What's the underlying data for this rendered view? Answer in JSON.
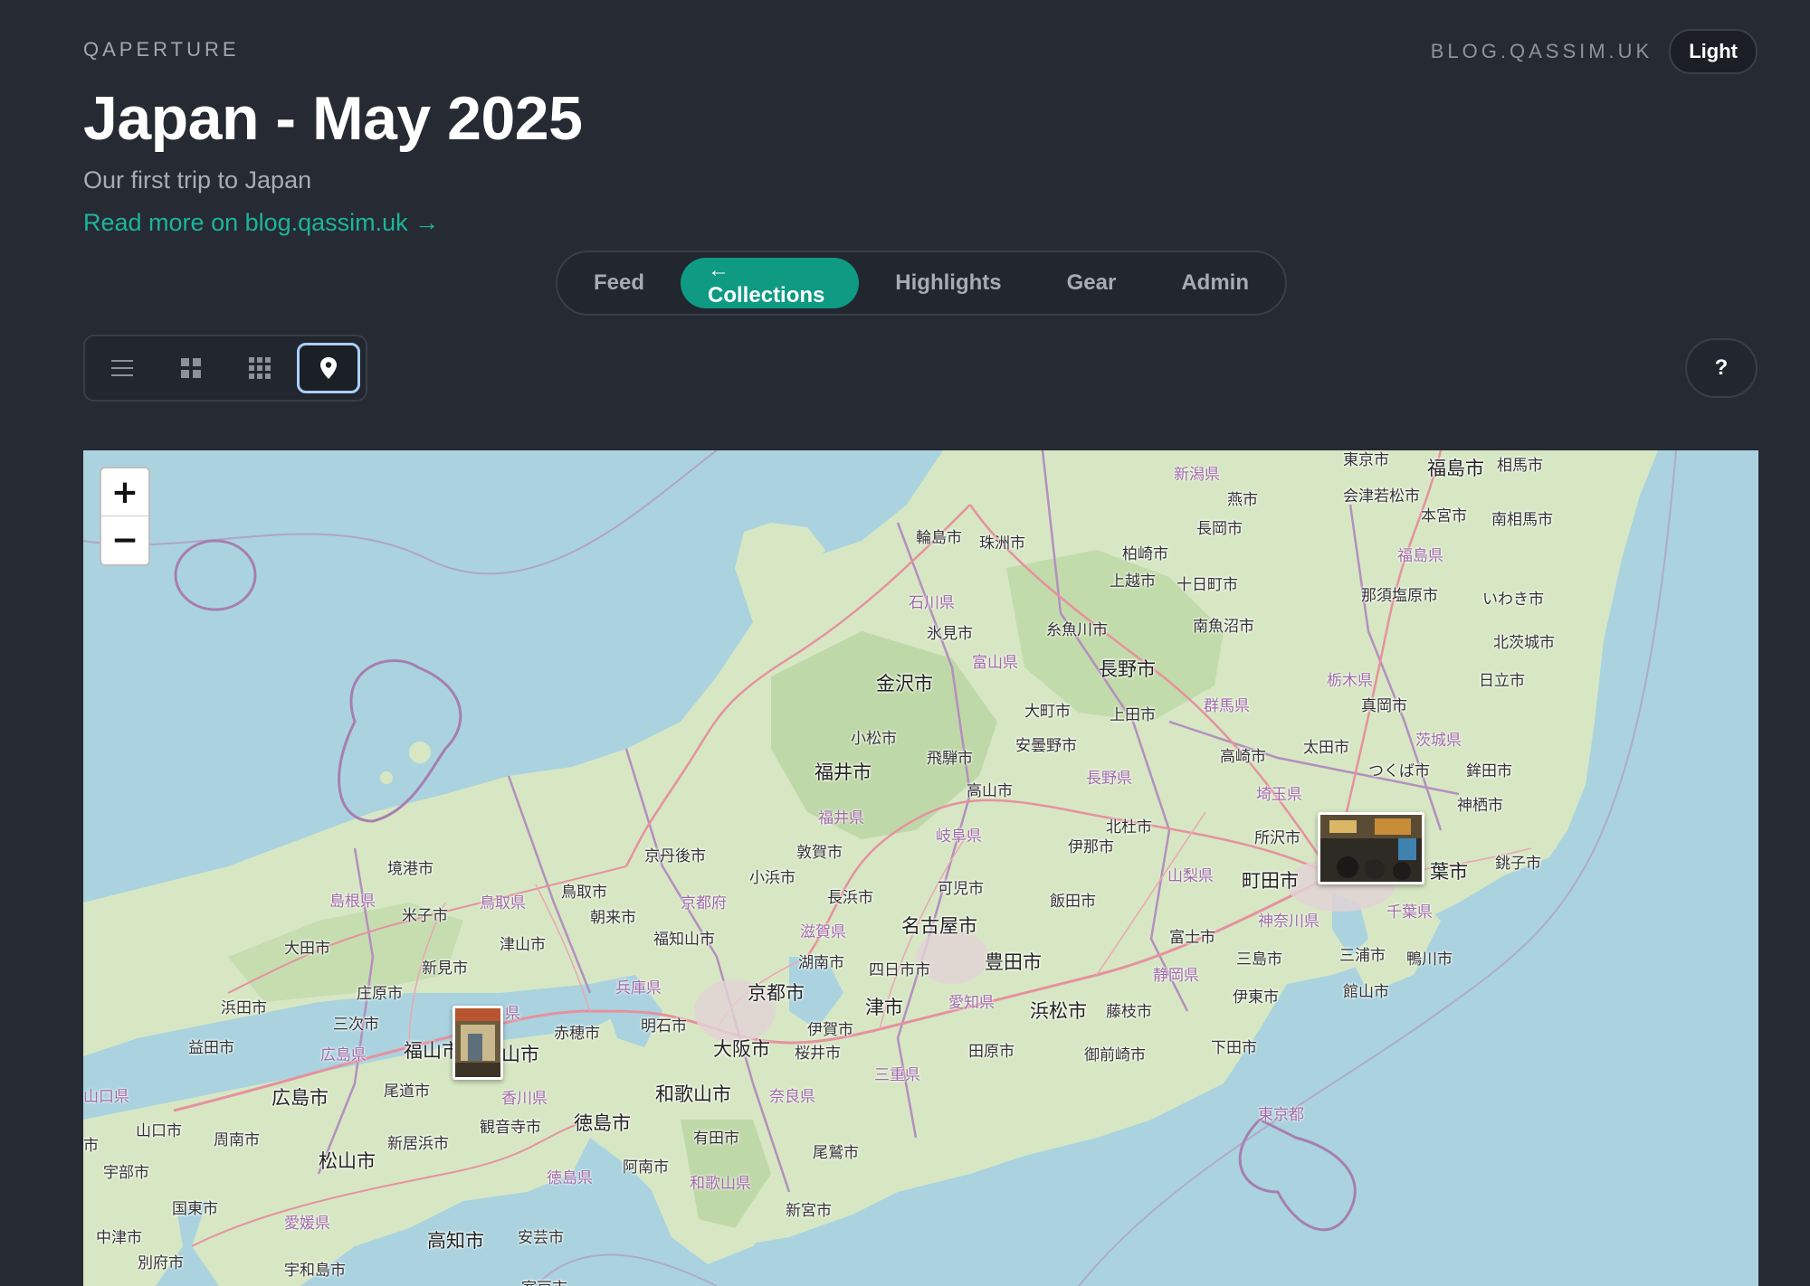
{
  "header": {
    "brand": "QAPERTURE",
    "blog_link": "BLOG.QASSIM.UK",
    "theme_toggle": "Light",
    "title": "Japan - May 2025",
    "subtitle": "Our first trip to Japan",
    "read_more": "Read more on blog.qassim.uk →"
  },
  "nav": {
    "items": [
      {
        "label": "Feed"
      },
      {
        "label": "← Collections"
      },
      {
        "label": "Highlights"
      },
      {
        "label": "Gear"
      },
      {
        "label": "Admin"
      }
    ],
    "active": "← Collections"
  },
  "view_modes": {
    "items": [
      "list-icon",
      "grid-large-icon",
      "grid-small-icon",
      "map-pin-icon"
    ],
    "active": "map-pin-icon"
  },
  "help_label": "?",
  "map": {
    "zoom_in": "+",
    "zoom_out": "−",
    "colors": {
      "sea": "#aad3df",
      "land": "#d8e8c7",
      "forest": "#b5d29d",
      "road": "#e892a2",
      "border": "#a77eb0"
    },
    "cities": {
      "niigata_pref": "新潟県",
      "fukushima_city": "福島市",
      "soma": "相馬市",
      "tsubame": "燕市",
      "aizuwakamatsu": "会津若松市",
      "motomiya": "本宮市",
      "minamisoma": "南相馬市",
      "nagaoka": "長岡市",
      "fukushima_pref": "福島県",
      "kashiwazaki": "柏崎市",
      "joetsu": "上越市",
      "tokamachi": "十日町市",
      "nasushiobara": "那須塩原市",
      "iwaki": "いわき市",
      "wajima": "輪島市",
      "suzu": "珠洲市",
      "ishikawa_pref": "石川県",
      "himi": "氷見市",
      "itoigawa": "糸魚川市",
      "minamiuonuma": "南魚沼市",
      "kitaibaraki": "北茨城市",
      "kanazawa": "金沢市",
      "toyama_pref": "富山県",
      "nagano": "長野市",
      "tochigi_pref": "栃木県",
      "hitachi": "日立市",
      "omachi": "大町市",
      "ueda": "上田市",
      "gunma_pref": "群馬県",
      "moka": "真岡市",
      "komatsu": "小松市",
      "hida": "飛騨市",
      "azumino": "安曇野市",
      "nagano_pref": "長野県",
      "takasaki": "高崎市",
      "ota": "太田市",
      "ibaraki_pref": "茨城県",
      "tsukuba": "つくば市",
      "hokota": "鉾田市",
      "fukui": "福井市",
      "takayama": "高山市",
      "saitama_pref": "埼玉県",
      "kamisu": "神栖市",
      "fukui_pref": "福井県",
      "hokuto": "北杜市",
      "tokorozawa": "所沢市",
      "gifu_pref": "岐阜県",
      "ina": "伊那市",
      "sakaiminato": "境港市",
      "kyotango": "京丹後市",
      "tsuruga": "敦賀市",
      "choshi": "銚子市",
      "obama": "小浜市",
      "kani": "可児市",
      "shimane_pref": "島根県",
      "tottori_pref": "鳥取県",
      "tottori": "鳥取市",
      "kyoto_pref": "京都府",
      "nagahama": "長浜市",
      "iida": "飯田市",
      "yamanashi_pref": "山梨県",
      "machida": "町田市",
      "chiba_city_tail": "葉市",
      "yonago": "米子市",
      "asago": "朝来市",
      "chiba_pref": "千葉県",
      "fukuchiyama": "福知山市",
      "shiga_pref": "滋賀県",
      "nagoya": "名古屋市",
      "kanagawa_pref": "神奈川県",
      "ota_shimane": "大田市",
      "tsuyama": "津山市",
      "fuji": "富士市",
      "shinmi": "新見市",
      "konan": "湖南市",
      "yokkaichi": "四日市市",
      "toyota": "豊田市",
      "mishima": "三島市",
      "miura": "三浦市",
      "kamogawa": "鴨川市",
      "shobara": "庄原市",
      "hyogo_pref": "兵庫県",
      "kyoto": "京都市",
      "shizuoka_pref": "静岡県",
      "tateyama": "館山市",
      "hamada": "浜田市",
      "tsu": "津市",
      "aichi_pref": "愛知県",
      "hamamatsu": "浜松市",
      "fujieda": "藤枝市",
      "ito": "伊東市",
      "miyoshi": "三次市",
      "okayama_pref_tail": "県",
      "akashi": "明石市",
      "iga": "伊賀市",
      "masuda": "益田市",
      "akaiwa": "赤穂市",
      "hiroshima_pref": "広島県",
      "fukuyama": "福山市",
      "okayama_tail": "山市",
      "osaka": "大阪市",
      "sakurai": "桜井市",
      "tahara": "田原市",
      "omaezaki": "御前崎市",
      "shimoda": "下田市",
      "mie_pref": "三重県",
      "onomichi": "尾道市",
      "kagawa_pref": "香川県",
      "wakayama": "和歌山市",
      "nara_pref": "奈良県",
      "yamaguchi_pref": "山口県",
      "hiroshima": "広島市",
      "kanonji": "観音寺市",
      "tokushima": "徳島市",
      "tokyo_pref": "東京都",
      "yamaguchi": "山口市",
      "shunan": "周南市",
      "niihama": "新居浜市",
      "arida": "有田市",
      "matsuyama": "松山市",
      "anan": "阿南市",
      "owase": "尾鷲市",
      "ube": "宇部市",
      "tokushima_pref": "徳島県",
      "wakayama_pref": "和歌山県",
      "kunisaki": "国東市",
      "shingu": "新宮市",
      "ehime_pref": "愛媛県",
      "nakatsu": "中津市",
      "kochi": "高知市",
      "aki": "安芸市",
      "beppu": "別府市",
      "uwajima": "宇和島市",
      "muroto": "室戸市",
      "tokyo_top": "東京市",
      "city_edge": "市"
    }
  }
}
